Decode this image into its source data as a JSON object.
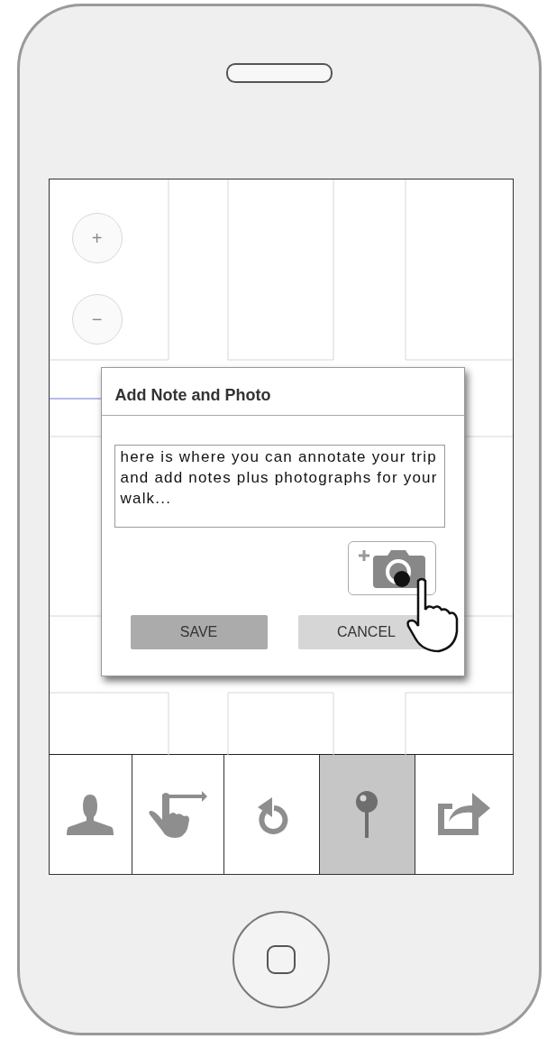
{
  "zoom_controls": [
    {
      "label": "+"
    },
    {
      "label": "−"
    }
  ],
  "dialog": {
    "title": "Add Note and Photo",
    "note": {
      "value": "here is where you can annotate your trip and add notes plus photographs for your walk..."
    },
    "buttons": [
      {
        "label": "SAVE",
        "kind": "primary"
      },
      {
        "label": "CANCEL",
        "kind": "secondary"
      }
    ]
  },
  "tab_bar": [
    {
      "kind": "profile",
      "selected": false
    },
    {
      "kind": "swipe",
      "selected": false
    },
    {
      "kind": "undo",
      "selected": false
    },
    {
      "kind": "pin",
      "selected": true
    },
    {
      "kind": "share",
      "selected": false
    }
  ]
}
